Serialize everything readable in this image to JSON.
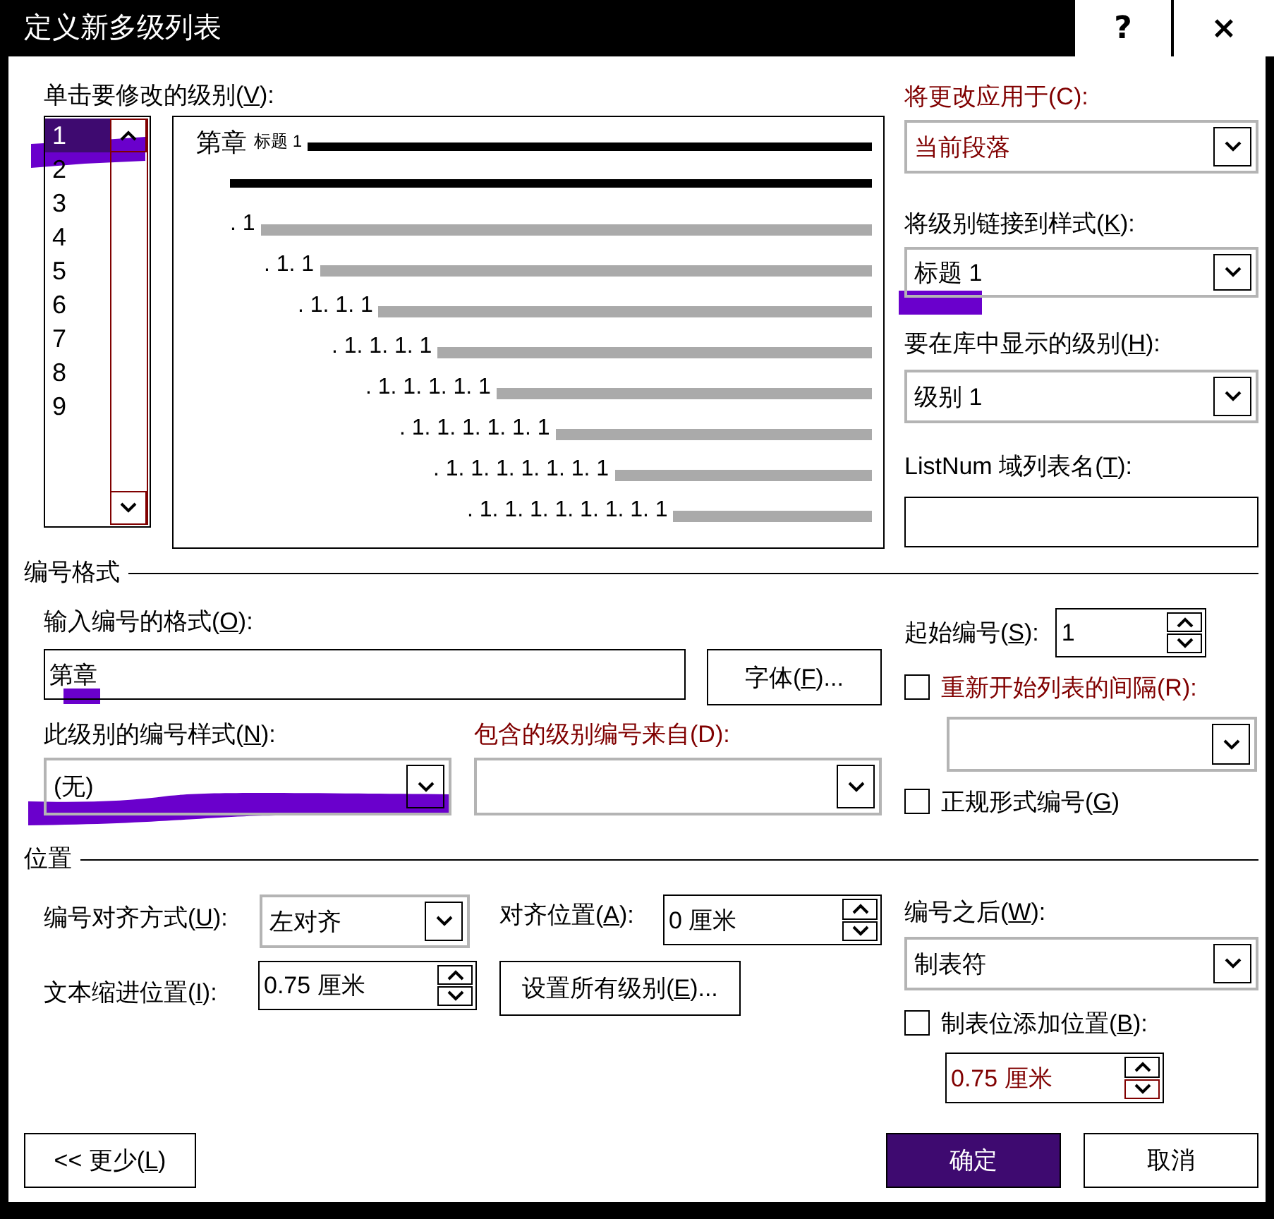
{
  "window": {
    "title": "定义新多级列表",
    "buttons": [
      {
        "kind": "help",
        "label": "?"
      },
      {
        "kind": "close",
        "label": "×"
      }
    ]
  },
  "level_picker": {
    "label": "单击要修改的级别(V):",
    "levels": [
      {
        "label": "1",
        "selected": true
      },
      {
        "label": "2",
        "selected": false
      },
      {
        "label": "3",
        "selected": false
      },
      {
        "label": "4",
        "selected": false
      },
      {
        "label": "5",
        "selected": false
      },
      {
        "label": "6",
        "selected": false
      },
      {
        "label": "7",
        "selected": false
      },
      {
        "label": "8",
        "selected": false
      },
      {
        "label": "9",
        "selected": false
      }
    ]
  },
  "preview": {
    "levels": [
      {
        "number": "第章",
        "style": "标题 1",
        "selected": true
      },
      {
        "number": ". 1",
        "selected": false
      },
      {
        "number": ". 1. 1",
        "selected": false
      },
      {
        "number": ". 1. 1. 1",
        "selected": false
      },
      {
        "number": ". 1. 1. 1. 1",
        "selected": false
      },
      {
        "number": ". 1. 1. 1. 1. 1",
        "selected": false
      },
      {
        "number": ". 1. 1. 1. 1. 1. 1",
        "selected": false
      },
      {
        "number": ". 1. 1. 1. 1. 1. 1. 1",
        "selected": false
      },
      {
        "number": ". 1. 1. 1. 1. 1. 1. 1. 1",
        "selected": false
      }
    ]
  },
  "apply_to": {
    "label": "将更改应用于(C):",
    "value": "当前段落",
    "disabled": true
  },
  "link_style": {
    "label": "将级别链接到样式(K):",
    "value": "标题 1",
    "disabled": false
  },
  "gallery_level": {
    "label": "要在库中显示的级别(H):",
    "value": "级别 1",
    "disabled": false
  },
  "listnum_name": {
    "label": "ListNum 域列表名(T):"
  },
  "number_format": {
    "title": "编号格式",
    "format_field": {
      "label": "输入编号的格式(O):",
      "value": "第章"
    },
    "font_button": "字体(F)...",
    "number_style": {
      "label": "此级别的编号样式(N):",
      "value": "(无)"
    },
    "include_level_from": {
      "label": "包含的级别编号来自(D):",
      "disabled": true
    },
    "start_at": {
      "label": "起始编号(S):",
      "value": "1"
    },
    "restart": {
      "label": "重新开始列表的间隔(R):",
      "checked": false,
      "disabled": true
    },
    "legal_style": {
      "label": "正规形式编号(G)",
      "checked": false
    }
  },
  "position": {
    "title": "位置",
    "alignment": {
      "label": "编号对齐方式(U):",
      "value": "左对齐"
    },
    "aligned_at": {
      "label": "对齐位置(A):",
      "value": "0 厘米"
    },
    "text_indent": {
      "label": "文本缩进位置(I):",
      "value": "0.75 厘米"
    },
    "set_all_button": "设置所有级别(E)...",
    "follow_with": {
      "label": "编号之后(W):",
      "value": "制表符"
    },
    "tab_stop": {
      "label": "制表位添加位置(B):",
      "checked": false
    },
    "tab_stop_at": {
      "value": "0.75 厘米",
      "disabled": true
    }
  },
  "buttons": [
    {
      "kind": "less",
      "label": "<< 更少(L)",
      "default": false
    },
    {
      "kind": "ok",
      "label": "确定",
      "default": true
    },
    {
      "kind": "cancel",
      "label": "取消",
      "default": false
    }
  ]
}
